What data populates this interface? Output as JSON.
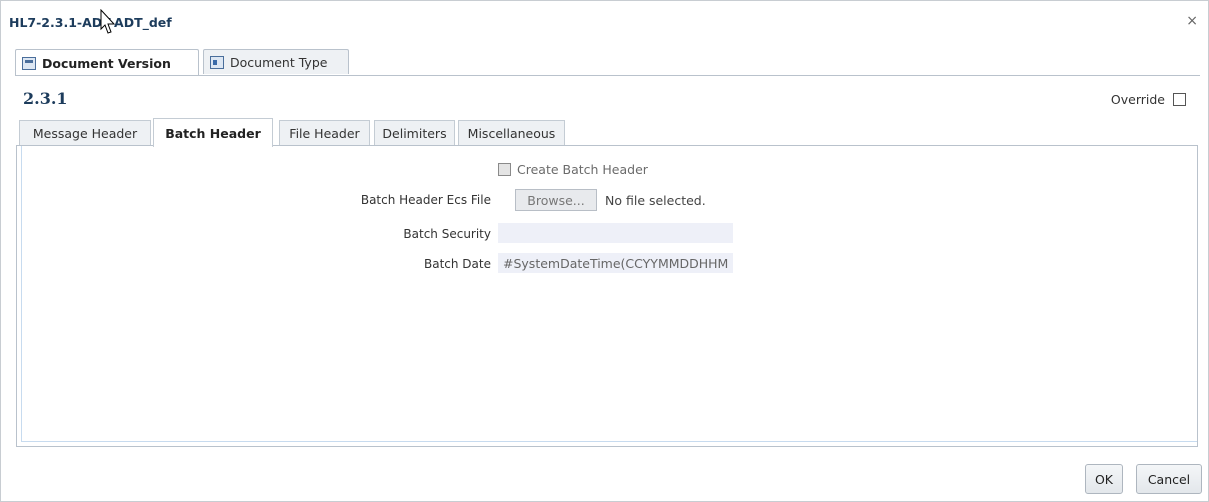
{
  "dialog": {
    "title": "HL7-2.3.1-ADT-ADT_def",
    "close_glyph": "×"
  },
  "outer_tabs": [
    {
      "label": "Document Version",
      "icon": "document-version-icon",
      "active": true
    },
    {
      "label": "Document Type",
      "icon": "document-type-icon",
      "active": false
    }
  ],
  "version": "2.3.1",
  "override": {
    "label": "Override",
    "checked": false
  },
  "inner_tabs": [
    {
      "label": "Message Header",
      "active": false
    },
    {
      "label": "Batch Header",
      "active": true
    },
    {
      "label": "File Header",
      "active": false
    },
    {
      "label": "Delimiters",
      "active": false
    },
    {
      "label": "Miscellaneous",
      "active": false
    }
  ],
  "form": {
    "create_batch_header": {
      "label": "Create Batch Header",
      "checked": false,
      "disabled": true
    },
    "ecs_file": {
      "label": "Batch Header Ecs File",
      "browse_label": "Browse...",
      "status": "No file selected."
    },
    "batch_security": {
      "label": "Batch Security",
      "value": ""
    },
    "batch_date": {
      "label": "Batch Date",
      "value": "#SystemDateTime(CCYYMMDDHHM"
    }
  },
  "footer": {
    "ok_label": "OK",
    "cancel_label": "Cancel"
  },
  "colors": {
    "title": "#1d3c5c",
    "border": "#b9c2cc",
    "field_bg": "#eef0f8"
  }
}
